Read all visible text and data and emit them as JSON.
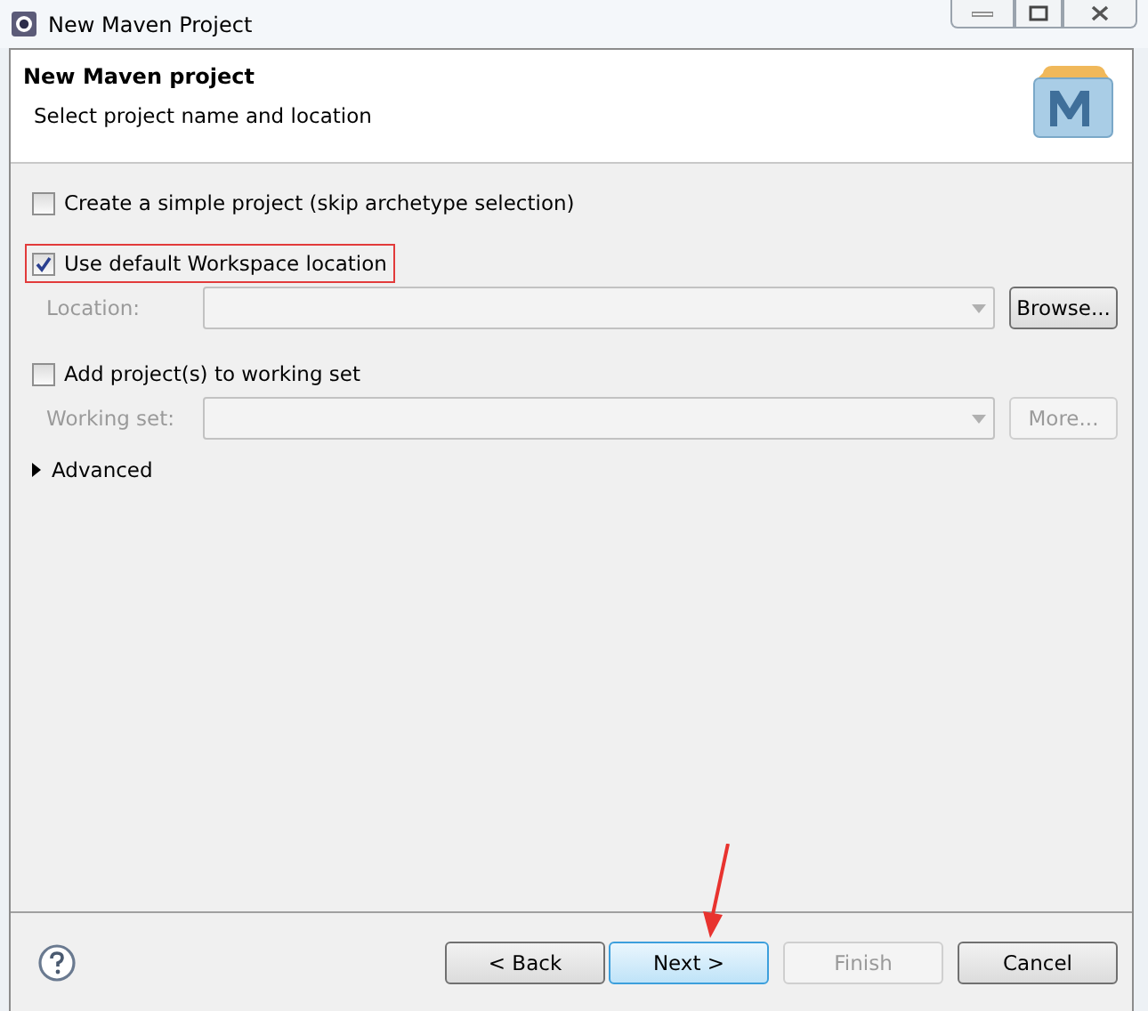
{
  "window": {
    "title": "New Maven Project"
  },
  "header": {
    "title": "New Maven project",
    "subtitle": "Select project name and location"
  },
  "rows": [
    {
      "kind": "checkbox",
      "label": "Create a simple project (skip archetype selection)",
      "checked": false,
      "highlighted": false
    },
    {
      "kind": "checkbox",
      "label": "Use default Workspace location",
      "checked": true,
      "highlighted": true
    },
    {
      "kind": "combo",
      "label": "Location:",
      "disabled": true,
      "button": {
        "label": "Browse...",
        "disabled": false
      }
    },
    {
      "kind": "checkbox",
      "label": "Add project(s) to working set",
      "checked": false,
      "highlighted": false
    },
    {
      "kind": "combo",
      "label": "Working set:",
      "disabled": true,
      "button": {
        "label": "More...",
        "disabled": true
      }
    },
    {
      "kind": "expander",
      "label": "Advanced",
      "expanded": false
    }
  ],
  "buttons": [
    {
      "label": "< Back",
      "disabled": false,
      "selected": false
    },
    {
      "label": "Next >",
      "disabled": false,
      "selected": true
    },
    {
      "label": "Finish",
      "disabled": true,
      "selected": false
    },
    {
      "label": "Cancel",
      "disabled": false,
      "selected": false
    }
  ]
}
